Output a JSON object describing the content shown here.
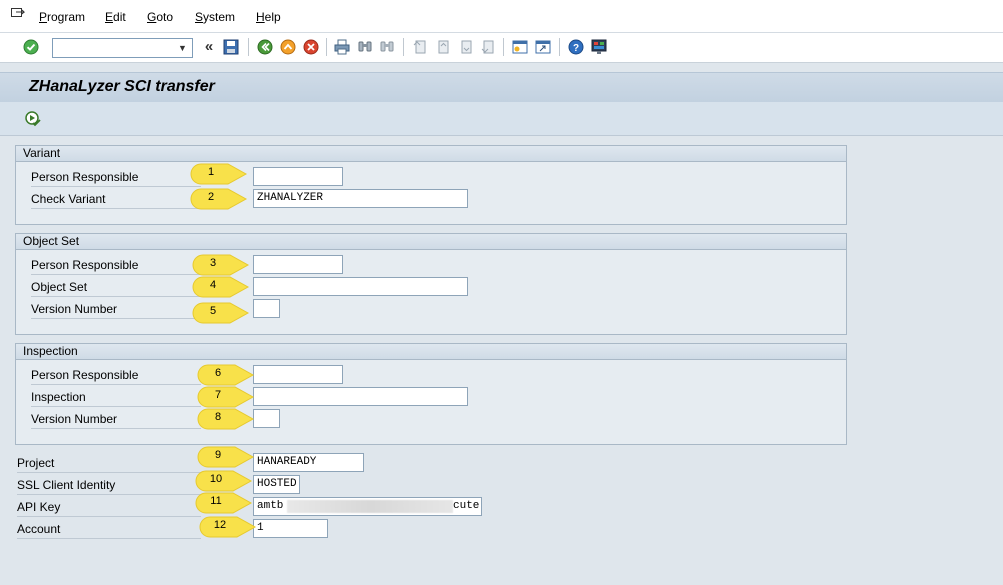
{
  "menu": {
    "items": [
      {
        "mnemonic": "P",
        "rest": "rogram"
      },
      {
        "mnemonic": "E",
        "rest": "dit"
      },
      {
        "mnemonic": "G",
        "rest": "oto"
      },
      {
        "mnemonic": "S",
        "rest": "ystem"
      },
      {
        "mnemonic": "H",
        "rest": "elp"
      }
    ]
  },
  "toolbar": {
    "command_field_value": "",
    "back_chevron": "«"
  },
  "title": "ZHanaLyzer SCI transfer",
  "groups": {
    "variant": {
      "header": "Variant",
      "person_responsible_label": "Person Responsible",
      "person_responsible_value": "",
      "check_variant_label": "Check Variant",
      "check_variant_value": "ZHANALYZER"
    },
    "object_set": {
      "header": "Object Set",
      "person_responsible_label": "Person Responsible",
      "person_responsible_value": "",
      "object_set_label": "Object Set",
      "object_set_value": "",
      "version_label": "Version Number",
      "version_value": ""
    },
    "inspection": {
      "header": "Inspection",
      "person_responsible_label": "Person Responsible",
      "person_responsible_value": "",
      "inspection_label": "Inspection",
      "inspection_value": "",
      "version_label": "Version Number",
      "version_value": ""
    }
  },
  "fields": {
    "project_label": "Project",
    "project_value": "HANAREADY",
    "ssl_label": "SSL Client Identity",
    "ssl_value": "HOSTED",
    "api_key_label": "API Key",
    "api_key_start": "amtb",
    "api_key_end": "cute",
    "account_label": "Account",
    "account_value": "1"
  },
  "callouts": [
    "1",
    "2",
    "3",
    "4",
    "5",
    "6",
    "7",
    "8",
    "9",
    "10",
    "11",
    "12"
  ],
  "colors": {
    "callout_fill": "#f8e14a",
    "background": "#dfe6ec",
    "group_border": "#a9b8c6"
  }
}
